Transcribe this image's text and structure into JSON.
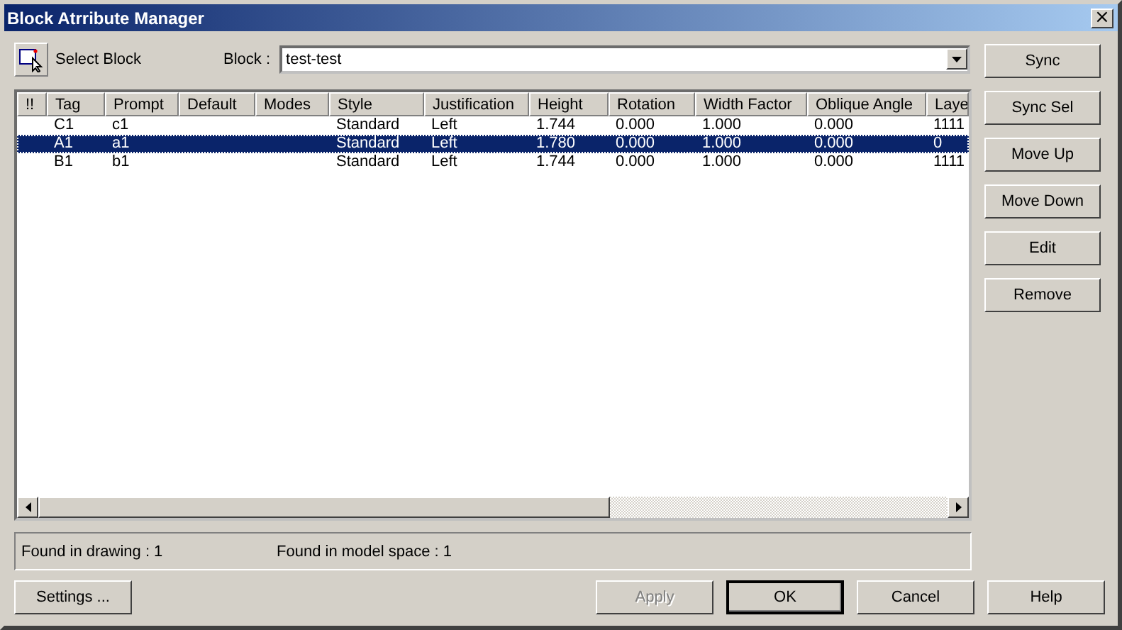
{
  "window": {
    "title": "Block Atrribute Manager",
    "close": "×"
  },
  "select_block": {
    "label": "Select Block"
  },
  "block_field": {
    "label": "Block :",
    "value": "test-test"
  },
  "table": {
    "columns": [
      "!!",
      "Tag",
      "Prompt",
      "Default",
      "Modes",
      "Style",
      "Justification",
      "Height",
      "Rotation",
      "Width Factor",
      "Oblique Angle",
      "Laye"
    ],
    "rows": [
      {
        "cells": [
          "",
          "C1",
          "c1",
          "",
          "",
          "Standard",
          "Left",
          "1.744",
          "0.000",
          "1.000",
          "0.000",
          "1111"
        ],
        "selected": false
      },
      {
        "cells": [
          "",
          "A1",
          "a1",
          "",
          "",
          "Standard",
          "Left",
          "1.780",
          "0.000",
          "1.000",
          "0.000",
          "0"
        ],
        "selected": true
      },
      {
        "cells": [
          "",
          "B1",
          "b1",
          "",
          "",
          "Standard",
          "Left",
          "1.744",
          "0.000",
          "1.000",
          "0.000",
          "1111"
        ],
        "selected": false
      }
    ]
  },
  "side_buttons": [
    "Sync",
    "Sync Sel",
    "Move Up",
    "Move Down",
    "Edit",
    "Remove"
  ],
  "status": [
    "Found in drawing : 1",
    "Found in model space : 1"
  ],
  "bottom_buttons": [
    {
      "label": "Settings ...",
      "disabled": false,
      "default": false
    },
    {
      "label": "Apply",
      "disabled": true,
      "default": false
    },
    {
      "label": "OK",
      "disabled": false,
      "default": true
    },
    {
      "label": "Cancel",
      "disabled": false,
      "default": false
    },
    {
      "label": "Help",
      "disabled": false,
      "default": false
    }
  ]
}
